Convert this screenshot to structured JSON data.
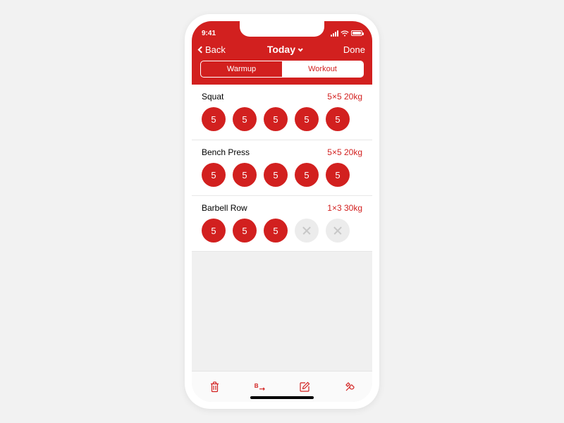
{
  "colors": {
    "accent": "#d2201f"
  },
  "status": {
    "time": "9:41"
  },
  "nav": {
    "back": "Back",
    "title": "Today",
    "done": "Done"
  },
  "segment": {
    "warmup": "Warmup",
    "workout": "Workout",
    "active": "workout"
  },
  "exercises": [
    {
      "name": "Squat",
      "meta": "5×5 20kg",
      "reps": [
        {
          "v": "5",
          "on": true
        },
        {
          "v": "5",
          "on": true
        },
        {
          "v": "5",
          "on": true
        },
        {
          "v": "5",
          "on": true
        },
        {
          "v": "5",
          "on": true
        }
      ]
    },
    {
      "name": "Bench Press",
      "meta": "5×5 20kg",
      "reps": [
        {
          "v": "5",
          "on": true
        },
        {
          "v": "5",
          "on": true
        },
        {
          "v": "5",
          "on": true
        },
        {
          "v": "5",
          "on": true
        },
        {
          "v": "5",
          "on": true
        }
      ]
    },
    {
      "name": "Barbell Row",
      "meta": "1×3 30kg",
      "reps": [
        {
          "v": "5",
          "on": true
        },
        {
          "v": "5",
          "on": true
        },
        {
          "v": "5",
          "on": true
        },
        {
          "v": "",
          "on": false
        },
        {
          "v": "",
          "on": false
        }
      ]
    }
  ],
  "tabbar": {
    "items": [
      "trash-icon",
      "switch-icon",
      "edit-icon",
      "tools-icon"
    ]
  }
}
